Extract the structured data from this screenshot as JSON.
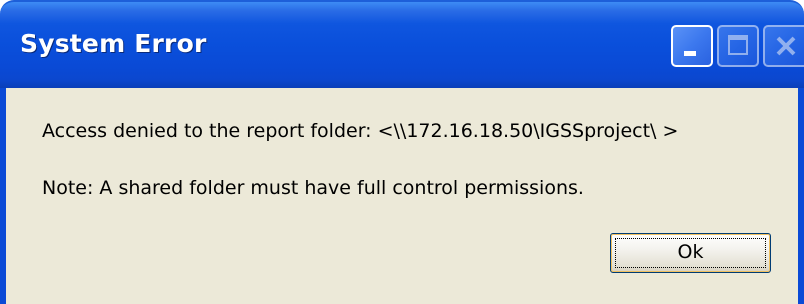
{
  "window": {
    "title": "System Error",
    "controls": {
      "minimize_icon": "minimize-icon",
      "maximize_icon": "maximize-icon",
      "close_icon": "close-icon"
    }
  },
  "dialog": {
    "message": "Access denied to the report folder: <\\\\172.16.18.50\\IGSSproject\\ >",
    "note": "Note: A shared folder must have full control permissions."
  },
  "buttons": {
    "ok_label": "Ok"
  },
  "colors": {
    "titlebar": "#0a4ad6",
    "client_background": "#ece9d8",
    "button_border": "#003c74"
  }
}
